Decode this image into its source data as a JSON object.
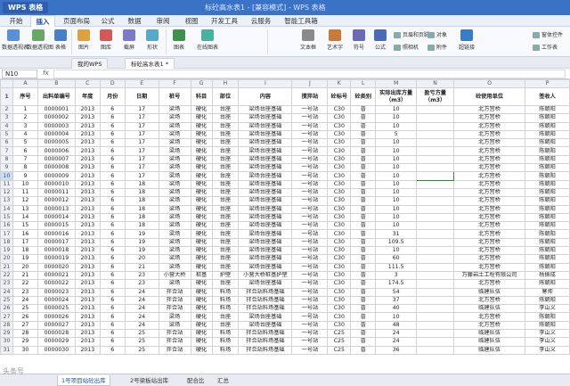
{
  "titlebar": {
    "app_name": "WPS 表格",
    "document_title": "标砼高水表1 - [兼容模式] - WPS 表格"
  },
  "menu_tabs": [
    "开始",
    "插入",
    "页面布局",
    "公式",
    "数据",
    "审阅",
    "视图",
    "开发工具",
    "云服务",
    "智能工具箱"
  ],
  "ribbon": {
    "buttons": [
      "数据透视表",
      "数据透视图",
      "表格",
      "图片",
      "图库",
      "截屏",
      "形状",
      "图表",
      "在线图表",
      "文本框",
      "艺术字",
      "符号",
      "公式",
      "附件",
      "超链接"
    ],
    "small_items": [
      "页眉和页脚",
      "对象",
      "照相机",
      "窗体控件",
      "工作表"
    ]
  },
  "doc_tabs": [
    "我的WPS",
    "标砼高水表1 *"
  ],
  "formula_bar": {
    "name_box": "N10",
    "fx": "fx",
    "value": ""
  },
  "column_letters": [
    "A",
    "B",
    "C",
    "D",
    "E",
    "F",
    "G",
    "H",
    "I",
    "J",
    "K",
    "L",
    "M",
    "N",
    "O",
    "P"
  ],
  "header_row": {
    "row_num": "1",
    "cells": [
      "序号",
      "出料单编号",
      "年度",
      "月份",
      "日期",
      "桩号",
      "科目",
      "部位",
      "内容",
      "搅拌站",
      "砼标号",
      "砼类别",
      "实际出库方量（m3）",
      "盈亏方量（m3）",
      "砼使用单位",
      "签收人"
    ]
  },
  "rows": [
    [
      "1",
      "0000001",
      "2013",
      "6",
      "17",
      "梁场",
      "硬化",
      "台座",
      "梁场台座基础",
      "一号站",
      "C30",
      "普",
      "10",
      "",
      "北方宫桥",
      "陈朝阳"
    ],
    [
      "2",
      "0000002",
      "2013",
      "6",
      "17",
      "梁场",
      "硬化",
      "台座",
      "梁场台座基础",
      "一号站",
      "C30",
      "普",
      "10",
      "",
      "北方宫桥",
      "陈朝阳"
    ],
    [
      "3",
      "0000003",
      "2013",
      "6",
      "17",
      "梁场",
      "硬化",
      "台座",
      "梁场台座基础",
      "一号站",
      "C30",
      "普",
      "10",
      "",
      "北方宫桥",
      "陈朝阳"
    ],
    [
      "4",
      "0000004",
      "2013",
      "6",
      "17",
      "梁场",
      "硬化",
      "台座",
      "梁场台座基础",
      "一号站",
      "C30",
      "普",
      "5",
      "",
      "北方宫桥",
      "陈朝阳"
    ],
    [
      "5",
      "0000005",
      "2013",
      "6",
      "17",
      "梁场",
      "硬化",
      "台座",
      "梁场台座基础",
      "一号站",
      "C30",
      "普",
      "10",
      "",
      "北方宫桥",
      "陈朝阳"
    ],
    [
      "6",
      "0000006",
      "2013",
      "6",
      "17",
      "梁场",
      "硬化",
      "台座",
      "梁场台座基础",
      "一号站",
      "C30",
      "普",
      "10",
      "",
      "北方宫桥",
      "陈朝阳"
    ],
    [
      "7",
      "0000007",
      "2013",
      "6",
      "17",
      "梁场",
      "硬化",
      "台座",
      "梁场台座基础",
      "一号站",
      "C30",
      "普",
      "10",
      "",
      "北方宫桥",
      "陈朝阳"
    ],
    [
      "8",
      "0000008",
      "2013",
      "6",
      "17",
      "梁场",
      "硬化",
      "台座",
      "梁场台座基础",
      "一号站",
      "C30",
      "普",
      "10",
      "",
      "北方宫桥",
      "陈朝阳"
    ],
    [
      "9",
      "0000009",
      "2013",
      "6",
      "17",
      "梁场",
      "硬化",
      "台座",
      "梁场台座基础",
      "一号站",
      "C30",
      "普",
      "10",
      "",
      "北方宫桥",
      "陈朝阳"
    ],
    [
      "10",
      "0000010",
      "2013",
      "6",
      "18",
      "梁场",
      "硬化",
      "台座",
      "梁场台座基础",
      "一号站",
      "C30",
      "普",
      "10",
      "",
      "北方宫桥",
      "陈朝阳"
    ],
    [
      "11",
      "0000011",
      "2013",
      "6",
      "18",
      "梁场",
      "硬化",
      "台座",
      "梁场台座基础",
      "一号站",
      "C30",
      "普",
      "10",
      "",
      "北方宫桥",
      "陈朝阳"
    ],
    [
      "12",
      "0000012",
      "2013",
      "6",
      "18",
      "梁场",
      "硬化",
      "台座",
      "梁场台座基础",
      "一号站",
      "C30",
      "普",
      "10",
      "",
      "北方宫桥",
      "陈朝阳"
    ],
    [
      "13",
      "0000013",
      "2013",
      "6",
      "18",
      "梁场",
      "硬化",
      "台座",
      "梁场台座基础",
      "一号站",
      "C30",
      "普",
      "10",
      "",
      "北方宫桥",
      "陈朝阳"
    ],
    [
      "14",
      "0000014",
      "2013",
      "6",
      "18",
      "梁场",
      "硬化",
      "台座",
      "梁场台座基础",
      "一号站",
      "C30",
      "普",
      "10",
      "",
      "北方宫桥",
      "陈朝阳"
    ],
    [
      "15",
      "0000015",
      "2013",
      "6",
      "18",
      "梁场",
      "硬化",
      "台座",
      "梁场台座基础",
      "一号站",
      "C30",
      "普",
      "10",
      "",
      "北方宫桥",
      "陈朝阳"
    ],
    [
      "16",
      "0000016",
      "2013",
      "6",
      "19",
      "梁场",
      "硬化",
      "台座",
      "梁场台座基础",
      "一号站",
      "C30",
      "普",
      "31",
      "",
      "北方宫桥",
      "陈朝阳"
    ],
    [
      "17",
      "0000017",
      "2013",
      "6",
      "19",
      "梁场",
      "硬化",
      "台座",
      "梁场台座基础",
      "一号站",
      "C30",
      "普",
      "109.5",
      "",
      "北方宫桥",
      "陈朝阳"
    ],
    [
      "18",
      "0000018",
      "2013",
      "6",
      "19",
      "梁场",
      "硬化",
      "台座",
      "梁场台座基础",
      "一号站",
      "C30",
      "普",
      "10",
      "",
      "北方宫桥",
      "陈朝阳"
    ],
    [
      "19",
      "0000019",
      "2013",
      "6",
      "20",
      "梁场",
      "硬化",
      "台座",
      "梁场台座基础",
      "一号站",
      "C30",
      "普",
      "60",
      "",
      "北方宫桥",
      "陈朝阳"
    ],
    [
      "20",
      "0000020",
      "2013",
      "6",
      "21",
      "梁场",
      "硬化",
      "台座",
      "梁场台座基础",
      "一号站",
      "C30",
      "普",
      "111.5",
      "",
      "北方宫桥",
      "陈朝阳"
    ],
    [
      "21",
      "0000021",
      "2013",
      "6",
      "23",
      "小营大桥",
      "桩基",
      "护壁",
      "小营大桥桩基护壁",
      "一号站",
      "C30",
      "普",
      "3",
      "",
      "万藤岩土工程有限公司",
      "杨振成"
    ],
    [
      "22",
      "0000022",
      "2013",
      "6",
      "23",
      "梁场",
      "硬化",
      "台座",
      "梁场台座基础",
      "一号站",
      "C30",
      "普",
      "174.5",
      "",
      "北方宫桥",
      "陈朝阳"
    ],
    [
      "23",
      "0000023",
      "2013",
      "6",
      "24",
      "拌合站",
      "硬化",
      "料场",
      "拌合站料场基础",
      "一号站",
      "C30",
      "普",
      "54",
      "",
      "临建队伍",
      "寒帅"
    ],
    [
      "24",
      "0000024",
      "2013",
      "6",
      "24",
      "拌合站",
      "硬化",
      "料场",
      "拌合站料场基础",
      "一号站",
      "C30",
      "普",
      "37",
      "",
      "北方宫桥",
      "陈朝阳"
    ],
    [
      "25",
      "0000025",
      "2013",
      "6",
      "24",
      "拌合站",
      "硬化",
      "料场",
      "拌合站料场基础",
      "一号站",
      "C30",
      "普",
      "40",
      "",
      "临建队伍",
      "李山义"
    ],
    [
      "26",
      "0000026",
      "2013",
      "6",
      "24",
      "梁场",
      "硬化",
      "台座",
      "梁场台座基础",
      "一号站",
      "C30",
      "普",
      "10",
      "",
      "北方宫桥",
      "陈朝阳"
    ],
    [
      "27",
      "0000027",
      "2013",
      "6",
      "24",
      "梁场",
      "硬化",
      "台座",
      "梁场台座基础",
      "一号站",
      "C30",
      "普",
      "48",
      "",
      "北方宫桥",
      "陈朝阳"
    ],
    [
      "28",
      "0000028",
      "2013",
      "6",
      "25",
      "拌合站",
      "硬化",
      "料场",
      "拌合站料场基础",
      "一号站",
      "C25",
      "普",
      "24",
      "",
      "临建队伍",
      "李山义"
    ],
    [
      "29",
      "0000029",
      "2013",
      "6",
      "25",
      "拌合站",
      "硬化",
      "料场",
      "拌合站料场基础",
      "一号站",
      "C25",
      "普",
      "24",
      "",
      "临建队伍",
      "李山义"
    ],
    [
      "30",
      "0000030",
      "2013",
      "6",
      "25",
      "拌合站",
      "硬化",
      "料场",
      "拌合站料场基础",
      "一号站",
      "C25",
      "普",
      "36",
      "",
      "临建队伍",
      "李山义"
    ]
  ],
  "row_numbers": [
    "2",
    "3",
    "4",
    "5",
    "6",
    "7",
    "8",
    "9",
    "10",
    "11",
    "12",
    "13",
    "14",
    "15",
    "16",
    "17",
    "18",
    "19",
    "20",
    "21",
    "22",
    "23",
    "24",
    "25",
    "26",
    "27",
    "28",
    "29",
    "30",
    "31"
  ],
  "sheet_tabs": [
    "1号项目站砼出库",
    "2号梁板站出库",
    "配合比",
    "汇总"
  ],
  "watermark": "头条号"
}
